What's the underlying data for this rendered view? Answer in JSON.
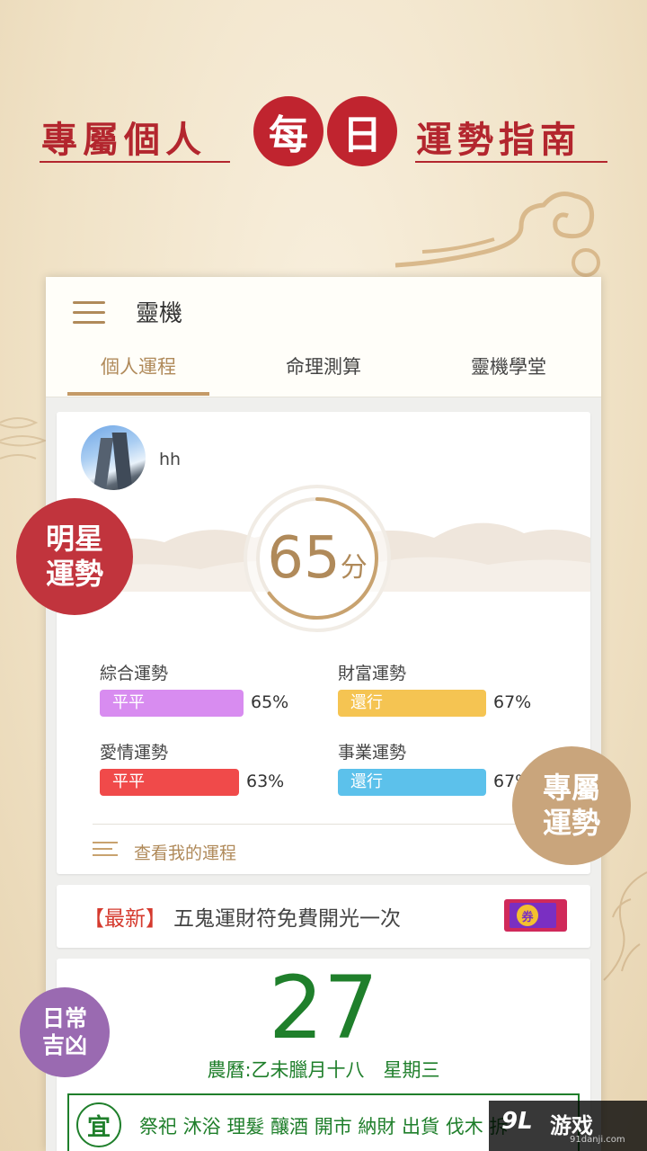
{
  "banner": {
    "left": "專屬個人",
    "circle1": "每",
    "circle2": "日",
    "right": "運勢指南"
  },
  "app": {
    "logo": "靈機",
    "tabs": [
      "個人運程",
      "命理測算",
      "靈機學堂"
    ],
    "active_tab": 0
  },
  "fortune": {
    "username": "hh",
    "score": 65,
    "score_unit": "分",
    "stats": [
      {
        "label": "綜合運勢",
        "level": "平平",
        "percent": "65%",
        "value": 65,
        "color": "#d88cf0"
      },
      {
        "label": "財富運勢",
        "level": "還行",
        "percent": "67%",
        "value": 67,
        "color": "#f5c452"
      },
      {
        "label": "愛情運勢",
        "level": "平平",
        "percent": "63%",
        "value": 63,
        "color": "#f04a4a"
      },
      {
        "label": "事業運勢",
        "level": "還行",
        "percent": "67%",
        "value": 67,
        "color": "#5cc1eb"
      }
    ],
    "view_link": "查看我的運程"
  },
  "news": {
    "tag": "【最新】",
    "text": "五鬼運財符免費開光一次",
    "coupon": "券"
  },
  "calendar": {
    "day": "27",
    "lunar": "農曆:乙未臘月十八　星期三",
    "yi_label": "宜",
    "yi_items": "祭祀 沐浴 理髮 釀酒 開市 納財 出貨 伐木 拆"
  },
  "badges": {
    "star": "明星\n運勢",
    "exclusive": "專屬\n運勢",
    "daily": "日常\n吉凶"
  },
  "watermark": {
    "logo": "9L",
    "main": "游戏",
    "sub": "91danji.com"
  },
  "colors": {
    "accent": "#b08a5a",
    "red": "#b3262e",
    "green": "#1f7f2b"
  }
}
